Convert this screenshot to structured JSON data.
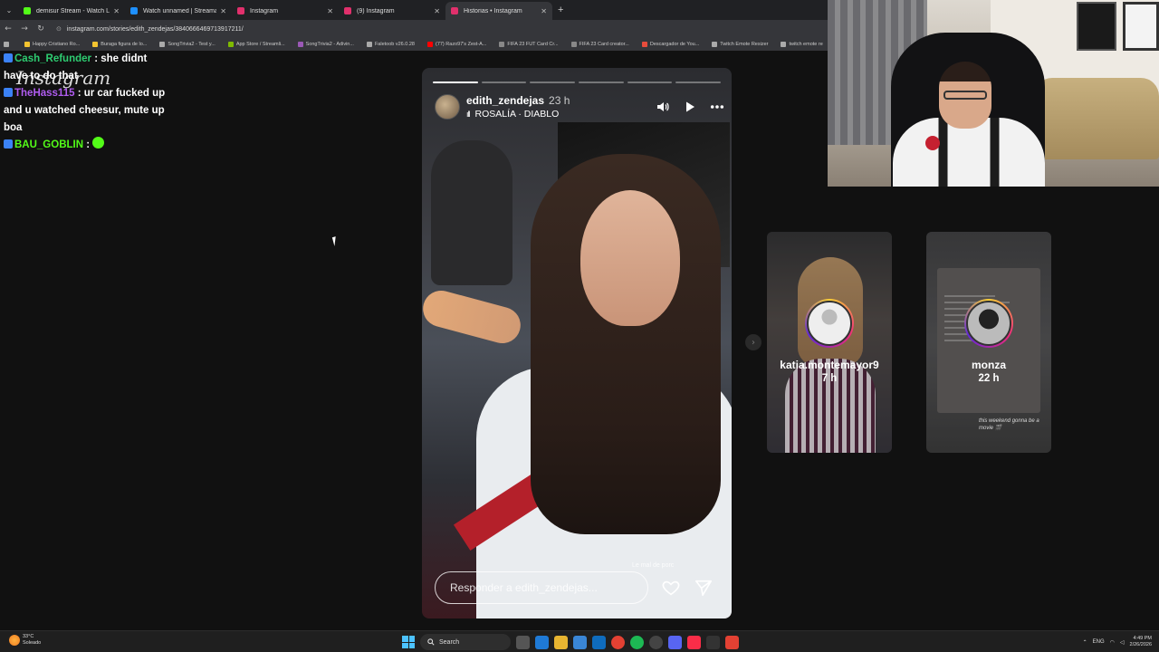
{
  "browser": {
    "tabs": [
      {
        "title": "demisur Stream - Watch Live o",
        "color": "#53fc18",
        "active": false
      },
      {
        "title": "Watch unnamed | Streamable",
        "color": "#1e90ff",
        "active": false
      },
      {
        "title": "Instagram",
        "color": "#e1306c",
        "active": false
      },
      {
        "title": "(9) Instagram",
        "color": "#e1306c",
        "active": false
      },
      {
        "title": "Historias • Instagram",
        "color": "#e1306c",
        "active": true
      }
    ],
    "url": "instagram.com/stories/edith_zendejas/3840666469713917211/",
    "bookmarks": [
      {
        "label": "Happy Cristiano Ro...",
        "color": "#f4c430"
      },
      {
        "label": "Buraga figura de lo...",
        "color": "#f4c430"
      },
      {
        "label": "SongTrivia2 - Test y...",
        "color": "#aaa"
      },
      {
        "label": "App Store / Streamli...",
        "color": "#7fba00"
      },
      {
        "label": "SongTrivia2 - Adivin...",
        "color": "#9b59b6"
      },
      {
        "label": "Faletoob v26.0.28",
        "color": "#aaa"
      },
      {
        "label": "(77) Razo97's Zest-A...",
        "color": "#ff0000"
      },
      {
        "label": "FIFA 23 FUT Card Cr...",
        "color": "#888"
      },
      {
        "label": "FIFA 23 Card creator...",
        "color": "#888"
      },
      {
        "label": "Descargador de You...",
        "color": "#e74c3c"
      },
      {
        "label": "Twitch Emote Resizer",
        "color": "#aaa"
      },
      {
        "label": "twitch emote re",
        "color": "#aaa"
      }
    ]
  },
  "chat": {
    "overlay_logo": "Instagram",
    "messages": [
      {
        "user": "Cash_Refunder",
        "user_color": "#2ecc71",
        "text": ": she didnt"
      },
      {
        "user": "",
        "user_color": "",
        "text": "have to do that"
      },
      {
        "user": "TheHass115",
        "user_color": "#b05cf0",
        "text": ": ur car fucked up"
      },
      {
        "user": "",
        "user_color": "",
        "text": "and u watched cheesur, mute up"
      },
      {
        "user": "",
        "user_color": "",
        "text": "boa"
      },
      {
        "user": "BAU_GOBLIN",
        "user_color": "#53fc18",
        "text": ":"
      }
    ]
  },
  "story": {
    "username": "edith_zendejas",
    "time": "23 h",
    "song": "ROSALÍA · DIABLO",
    "progress_segments": 6,
    "progress_done": 1,
    "caption": "Le mal de porc",
    "reply_placeholder": "Responder a edith_zendejas..."
  },
  "previews": [
    {
      "username": "katia.montemayor9",
      "time": "7 h"
    },
    {
      "username": "monza",
      "time": "22 h",
      "caption": "this weekend gonna be a movie 🎬"
    }
  ],
  "taskbar": {
    "temp": "33°C",
    "weather": "Soleado",
    "search": "Search",
    "lang": "ENG",
    "time": "4:49 PM",
    "date": "2/26/2026"
  }
}
